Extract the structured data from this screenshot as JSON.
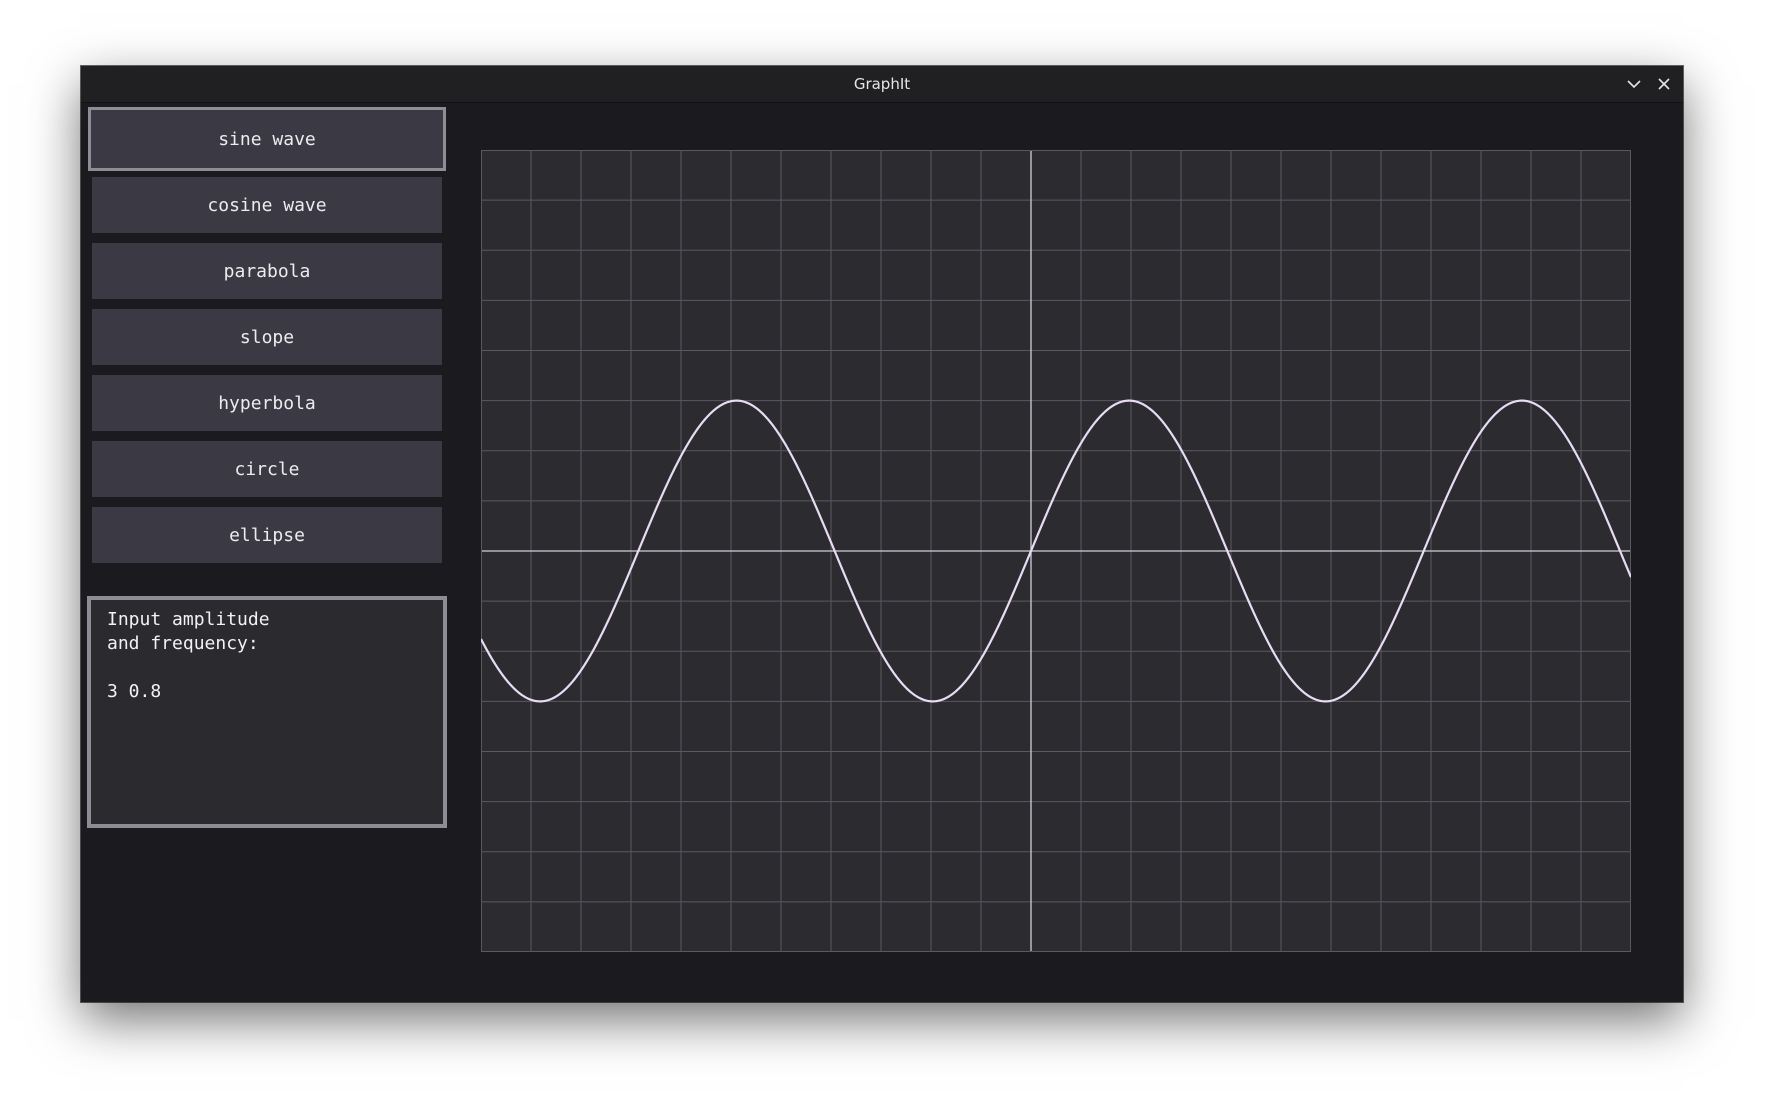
{
  "window": {
    "title": "GraphIt"
  },
  "sidebar": {
    "items": [
      {
        "label": "sine wave",
        "active": true
      },
      {
        "label": "cosine wave",
        "active": false
      },
      {
        "label": "parabola",
        "active": false
      },
      {
        "label": "slope",
        "active": false
      },
      {
        "label": "hyperbola",
        "active": false
      },
      {
        "label": "circle",
        "active": false
      },
      {
        "label": "ellipse",
        "active": false
      }
    ]
  },
  "input": {
    "prompt_line_1": "Input amplitude",
    "prompt_line_2": "and frequency:",
    "value": "3 0.8"
  },
  "icons": {
    "minimize": "chevron-down-icon",
    "close": "close-icon"
  },
  "colors": {
    "window_bg": "#1b1b1f",
    "button_bg": "#3b3a44",
    "graph_bg": "#2c2b2f",
    "grid": "#5a5960",
    "axis": "#d0cfd6",
    "curve": "#e8dcf4"
  },
  "chart_data": {
    "type": "line",
    "function": "y = 3*sin(0.8*x)",
    "series": [
      {
        "amplitude": 3,
        "frequency": 0.8
      }
    ],
    "xlim": [
      -11,
      12
    ],
    "ylim": [
      -8,
      8
    ],
    "grid": true
  }
}
